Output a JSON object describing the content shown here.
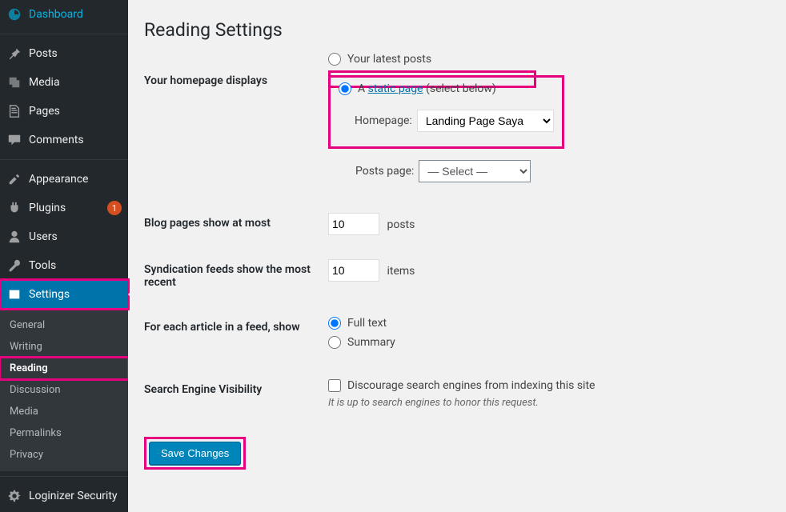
{
  "page_title": "Reading Settings",
  "sidebar": {
    "items": [
      {
        "label": "Dashboard",
        "icon": "dashboard"
      },
      {
        "label": "Posts",
        "icon": "pin"
      },
      {
        "label": "Media",
        "icon": "media"
      },
      {
        "label": "Pages",
        "icon": "pages"
      },
      {
        "label": "Comments",
        "icon": "comments"
      },
      {
        "label": "Appearance",
        "icon": "appearance"
      },
      {
        "label": "Plugins",
        "icon": "plugins",
        "badge": "1"
      },
      {
        "label": "Users",
        "icon": "users"
      },
      {
        "label": "Tools",
        "icon": "tools"
      },
      {
        "label": "Settings",
        "icon": "settings",
        "current": true
      }
    ],
    "submenu": [
      {
        "label": "General"
      },
      {
        "label": "Writing"
      },
      {
        "label": "Reading",
        "current": true
      },
      {
        "label": "Discussion"
      },
      {
        "label": "Media"
      },
      {
        "label": "Permalinks"
      },
      {
        "label": "Privacy"
      }
    ],
    "bottom": [
      {
        "label": "Loginizer Security",
        "icon": "gear"
      }
    ]
  },
  "form": {
    "homepage_displays_label": "Your homepage displays",
    "opt_latest": "Your latest posts",
    "opt_static_prefix": "A ",
    "opt_static_link": "static page",
    "opt_static_suffix": " (select below)",
    "homepage_label": "Homepage:",
    "homepage_value": "Landing Page Saya",
    "postspage_label": "Posts page:",
    "postspage_value": "— Select —",
    "blog_pages_label": "Blog pages show at most",
    "blog_pages_value": "10",
    "blog_pages_unit": "posts",
    "syndication_label": "Syndication feeds show the most recent",
    "syndication_value": "10",
    "syndication_unit": "items",
    "feed_label": "For each article in a feed, show",
    "feed_full": "Full text",
    "feed_summary": "Summary",
    "sev_label": "Search Engine Visibility",
    "sev_check": "Discourage search engines from indexing this site",
    "sev_desc": "It is up to search engines to honor this request.",
    "save": "Save Changes"
  }
}
